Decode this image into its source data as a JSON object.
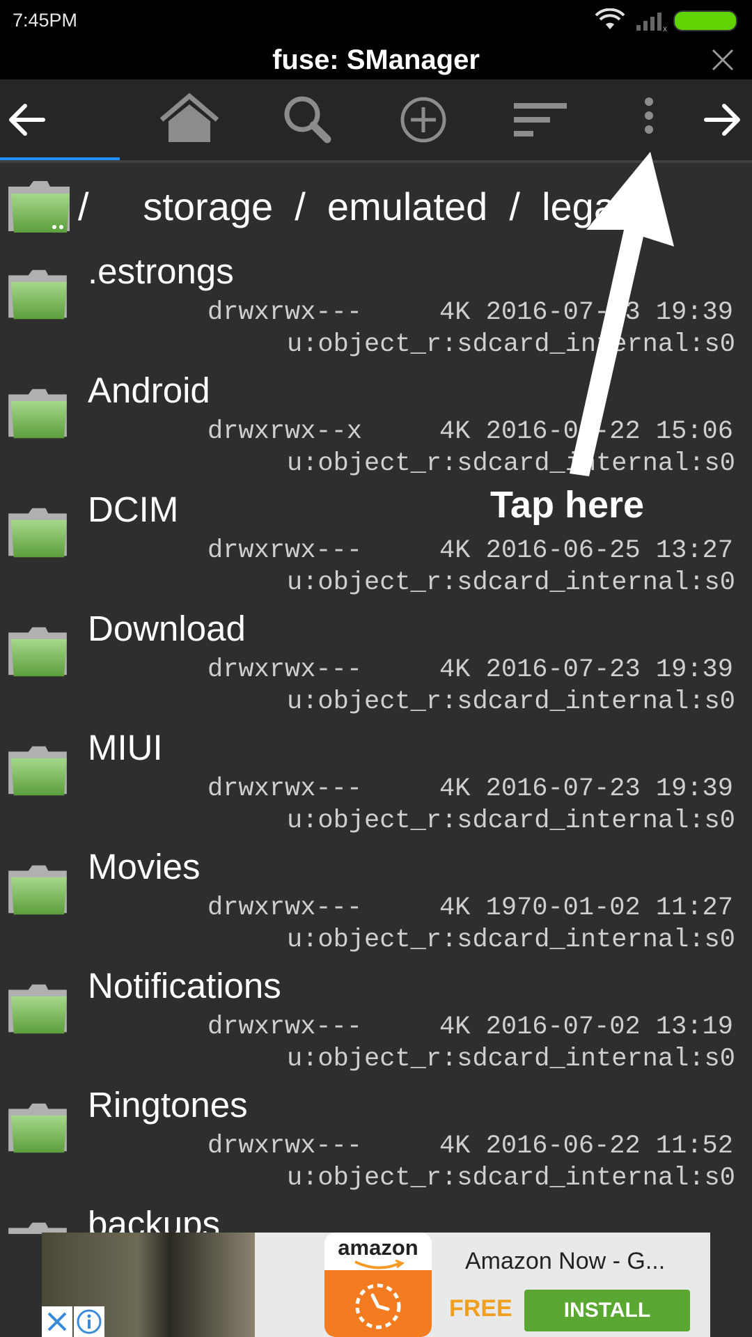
{
  "status_bar": {
    "time": "7:45PM",
    "battery_color": "#5fd400"
  },
  "title_bar": {
    "title": "fuse: SManager"
  },
  "toolbar": {
    "icons": [
      "back-arrow-icon",
      "home-icon",
      "search-icon",
      "add-circle-icon",
      "sort-icon",
      "more-vert-icon",
      "forward-arrow-icon"
    ],
    "accent_color": "#1e90ff"
  },
  "path": {
    "text": "/     storage  /  emulated  /  legacy"
  },
  "files": [
    {
      "name": ".estrongs",
      "perm": "drwxrwx---     4K 2016-07-23 19:39",
      "context": "u:object_r:sdcard_internal:s0"
    },
    {
      "name": "Android",
      "perm": "drwxrwx--x     4K 2016-06-22 15:06",
      "context": "u:object_r:sdcard_internal:s0"
    },
    {
      "name": "DCIM",
      "perm": "drwxrwx---     4K 2016-06-25 13:27",
      "context": "u:object_r:sdcard_internal:s0"
    },
    {
      "name": "Download",
      "perm": "drwxrwx---     4K 2016-07-23 19:39",
      "context": "u:object_r:sdcard_internal:s0"
    },
    {
      "name": "MIUI",
      "perm": "drwxrwx---     4K 2016-07-23 19:39",
      "context": "u:object_r:sdcard_internal:s0"
    },
    {
      "name": "Movies",
      "perm": "drwxrwx---     4K 1970-01-02 11:27",
      "context": "u:object_r:sdcard_internal:s0"
    },
    {
      "name": "Notifications",
      "perm": "drwxrwx---     4K 2016-07-02 13:19",
      "context": "u:object_r:sdcard_internal:s0"
    },
    {
      "name": "Ringtones",
      "perm": "drwxrwx---     4K 2016-06-22 11:52",
      "context": "u:object_r:sdcard_internal:s0"
    },
    {
      "name": "backups",
      "perm": "",
      "context": ""
    }
  ],
  "annotation": {
    "label": "Tap here"
  },
  "ad": {
    "brand": "amazon",
    "title": "Amazon Now - G...",
    "price": "FREE",
    "install_label": "INSTALL"
  }
}
